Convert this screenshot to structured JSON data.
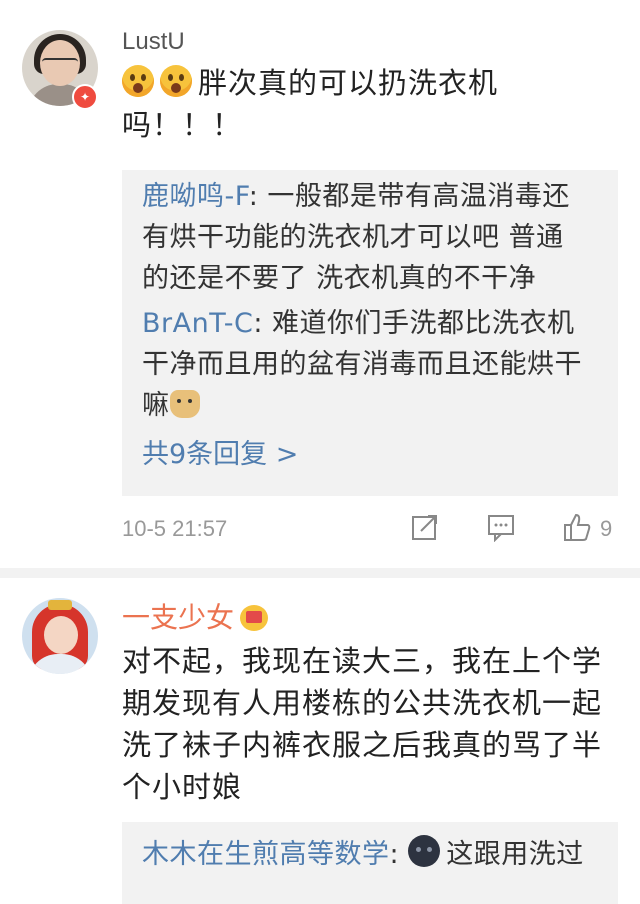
{
  "comments": [
    {
      "username": "LustU",
      "text_emojis": [
        "scream-emoji",
        "scream-emoji"
      ],
      "text": "胖次真的可以扔洗衣机吗！！！",
      "text_line1": "胖次真的可以扔洗衣机",
      "text_line2": "吗！！！",
      "badge_color": "#ef4b3f",
      "replies": [
        {
          "name": "鹿呦鸣-F",
          "sep": ":",
          "line1": " 一般都是带有高温消毒还",
          "line2": "有烘干功能的洗衣机才可以吧 普通",
          "line3": "的还是不要了 洗衣机真的不干净"
        },
        {
          "name": "BrAnT-C",
          "sep": ":",
          "line1": " 难道你们手洗都比洗衣机",
          "line2": "干净而且用的盆有消毒而且还能烘干",
          "line3": "嘛",
          "trailing_emoji": "doge-emoji"
        }
      ],
      "more_replies": "共9条回复 >",
      "time": "10-5  21:57",
      "likes": "9"
    },
    {
      "username": "一支少女",
      "username_color": "#eb7350",
      "username_badge": "crown-emoji",
      "text_line1": "对不起，我现在读大三，我在上个学",
      "text_line2": "期发现有人用楼栋的公共洗衣机一起",
      "text_line3": "洗了袜子内裤衣服之后我真的骂了半",
      "text_line4": "个小时娘",
      "reply_preview": {
        "name": "木木在生煎高等数学",
        "sep": ":",
        "emoji": "dark-face-emoji",
        "text": "这跟用洗过"
      }
    }
  ],
  "colors": {
    "link_blue": "#507daf",
    "reply_bg": "#f2f2f2",
    "meta_gray": "#999999"
  }
}
